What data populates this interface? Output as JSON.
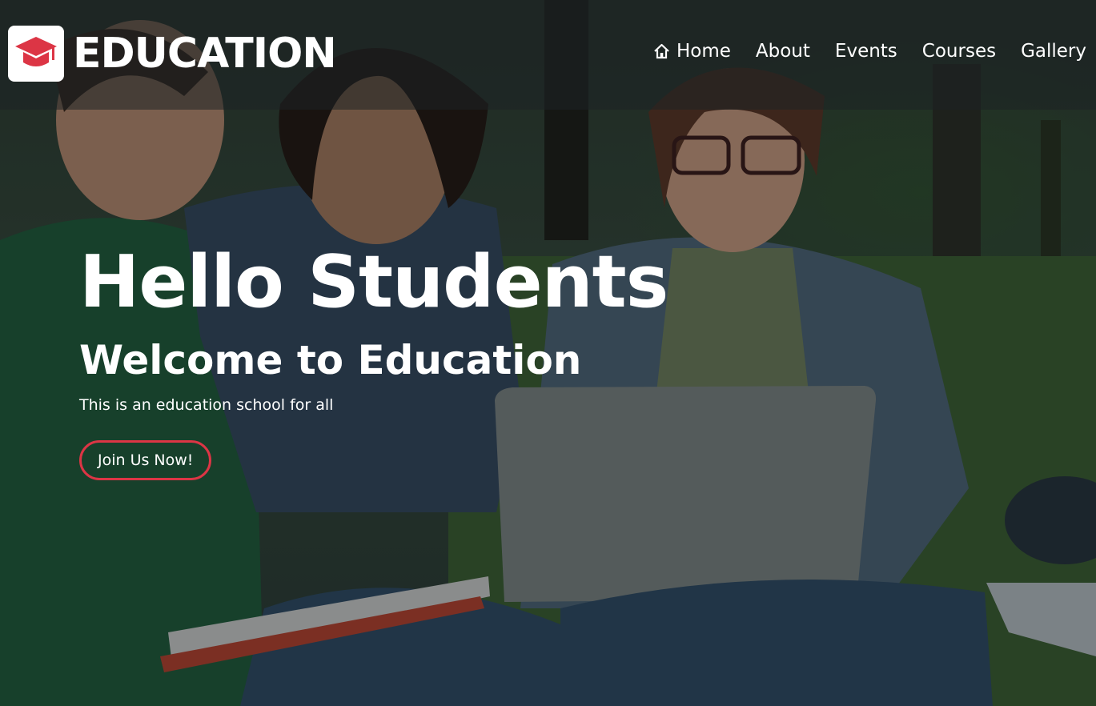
{
  "brand": {
    "name": "EDUCATION",
    "icon": "graduation-cap-icon",
    "icon_color": "#dc3545"
  },
  "nav": {
    "items": [
      {
        "label": "Home",
        "icon": "home-icon"
      },
      {
        "label": "About"
      },
      {
        "label": "Events"
      },
      {
        "label": "Courses"
      },
      {
        "label": "Gallery"
      }
    ]
  },
  "hero": {
    "title": "Hello Students",
    "subtitle": "Welcome to Education",
    "text": "This is an education school for all",
    "cta_label": "Join Us Now!",
    "accent_color": "#dc3545"
  }
}
